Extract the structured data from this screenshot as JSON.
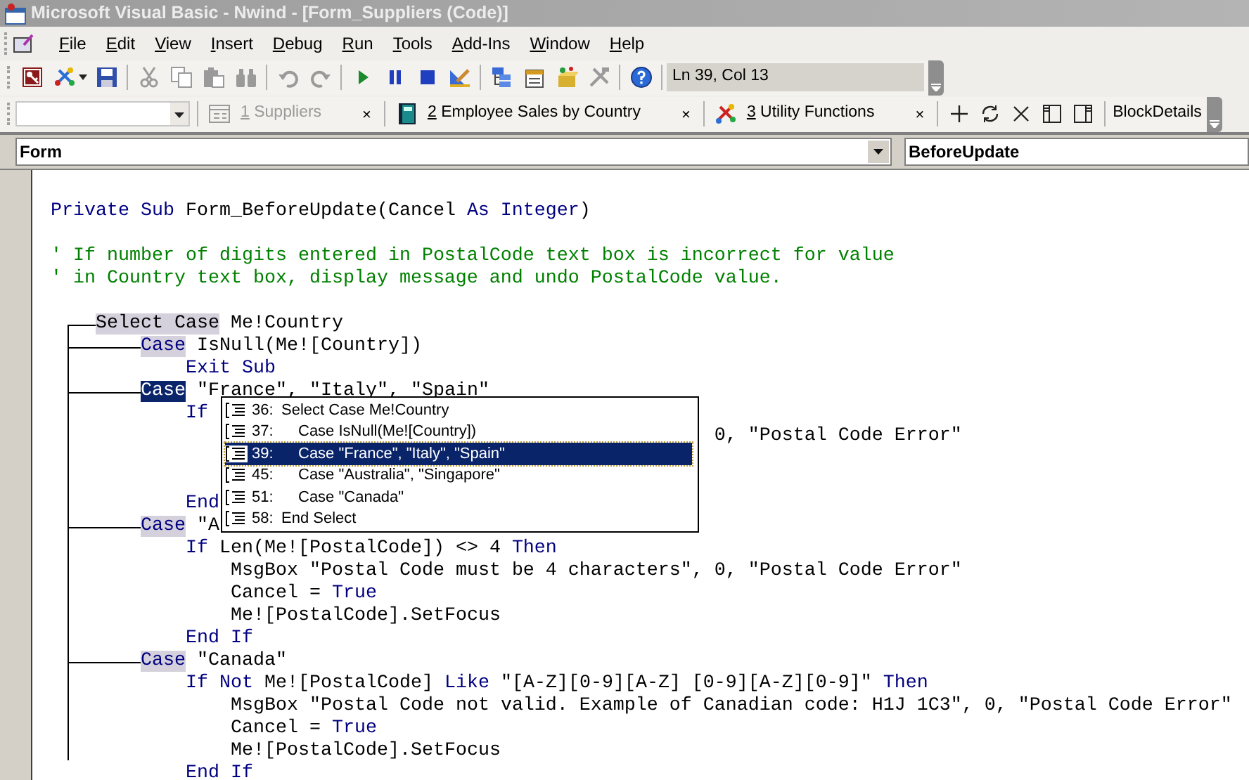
{
  "window": {
    "title": "Microsoft Visual Basic - Nwind - [Form_Suppliers (Code)]"
  },
  "menu": [
    {
      "mnemonic": "F",
      "rest": "ile"
    },
    {
      "mnemonic": "E",
      "rest": "dit"
    },
    {
      "mnemonic": "V",
      "rest": "iew"
    },
    {
      "mnemonic": "I",
      "rest": "nsert"
    },
    {
      "mnemonic": "D",
      "rest": "ebug"
    },
    {
      "mnemonic": "R",
      "rest": "un"
    },
    {
      "mnemonic": "T",
      "rest": "ools"
    },
    {
      "mnemonic": "A",
      "rest": "dd-Ins"
    },
    {
      "mnemonic": "W",
      "rest": "indow"
    },
    {
      "mnemonic": "H",
      "rest": "elp"
    }
  ],
  "standard_toolbar": {
    "groups": [
      [
        {
          "kind": "access",
          "disabled": false
        },
        {
          "kind": "insert",
          "disabled": false
        },
        {
          "kind": "save",
          "disabled": false
        }
      ],
      [
        {
          "kind": "cut",
          "disabled": true
        },
        {
          "kind": "copy",
          "disabled": true
        },
        {
          "kind": "paste",
          "disabled": true
        },
        {
          "kind": "find",
          "disabled": true
        }
      ],
      [
        {
          "kind": "undo",
          "disabled": true
        },
        {
          "kind": "redo",
          "disabled": true
        }
      ],
      [
        {
          "kind": "run",
          "disabled": false
        },
        {
          "kind": "pause",
          "disabled": false
        },
        {
          "kind": "stop",
          "disabled": false
        },
        {
          "kind": "design",
          "disabled": false
        }
      ],
      [
        {
          "kind": "project",
          "disabled": false
        },
        {
          "kind": "properties",
          "disabled": false
        },
        {
          "kind": "browser",
          "disabled": false
        },
        {
          "kind": "toolbox",
          "disabled": true
        }
      ],
      [
        {
          "kind": "help",
          "disabled": false
        }
      ]
    ],
    "position": "Ln 39, Col 13"
  },
  "bookmark_toolbar": {
    "tabs": [
      {
        "kind": "form",
        "key": "1",
        "label": "Suppliers",
        "disabled": true,
        "close": "×"
      },
      {
        "kind": "book",
        "key": "2",
        "label": "Employee Sales by Country",
        "disabled": false,
        "close": "×"
      },
      {
        "kind": "tools",
        "key": "3",
        "label": "Utility Functions",
        "disabled": false,
        "close": "×"
      }
    ],
    "actions": [
      {
        "kind": "add"
      },
      {
        "kind": "refresh"
      },
      {
        "kind": "delete"
      },
      {
        "kind": "panel_left"
      },
      {
        "kind": "panel_right"
      }
    ],
    "label": "BlockDetails"
  },
  "object_box": {
    "value": "Form"
  },
  "procedure_box": {
    "value": "BeforeUpdate"
  },
  "code": {
    "lines": [
      {
        "kind": "code",
        "segments": [
          {
            "kind": "keyword",
            "text": "Private Sub"
          },
          {
            "kind": "plain",
            "text": " Form_BeforeUpdate(Cancel "
          },
          {
            "kind": "keyword",
            "text": "As Integer"
          },
          {
            "kind": "plain",
            "text": ")"
          }
        ]
      },
      {
        "kind": "blank"
      },
      {
        "kind": "code",
        "segments": [
          {
            "kind": "comment",
            "text": "' If number of digits entered in PostalCode text box is incorrect for value"
          }
        ]
      },
      {
        "kind": "code",
        "segments": [
          {
            "kind": "comment",
            "text": "' in Country text box, display message and undo PostalCode value."
          }
        ]
      },
      {
        "kind": "blank"
      },
      {
        "kind": "branch_start",
        "segments": [
          {
            "kind": "block_plain",
            "text": "    Select Case"
          },
          {
            "kind": "plain",
            "text": " Me!Country"
          }
        ]
      },
      {
        "kind": "branch",
        "segments": [
          {
            "kind": "block_keyword",
            "text": "        Case"
          },
          {
            "kind": "plain",
            "text": " IsNull(Me![Country])"
          }
        ]
      },
      {
        "kind": "code",
        "segments": [
          {
            "kind": "keyword",
            "text": "            Exit Sub"
          }
        ]
      },
      {
        "kind": "branch",
        "segments": [
          {
            "kind": "selected_keyword",
            "text": "        Case"
          },
          {
            "kind": "plain",
            "text": " \"France\", \"Italy\", \"Spain\""
          }
        ]
      },
      {
        "kind": "code",
        "segments": [
          {
            "kind": "keyword",
            "text": "            If"
          }
        ]
      },
      {
        "kind": "code",
        "segments": [
          {
            "kind": "plain",
            "text": "                                                           0, \"Postal Code Error\""
          }
        ]
      },
      {
        "kind": "blank"
      },
      {
        "kind": "blank"
      },
      {
        "kind": "code",
        "segments": [
          {
            "kind": "keyword",
            "text": "            End"
          }
        ]
      },
      {
        "kind": "branch",
        "segments": [
          {
            "kind": "block_keyword",
            "text": "        Case"
          },
          {
            "kind": "plain",
            "text": " \"A"
          }
        ]
      },
      {
        "kind": "code",
        "segments": [
          {
            "kind": "keyword",
            "text": "            If"
          },
          {
            "kind": "plain",
            "text": " Len(Me![PostalCode]) <> 4 "
          },
          {
            "kind": "keyword",
            "text": "Then"
          }
        ]
      },
      {
        "kind": "code",
        "segments": [
          {
            "kind": "plain",
            "text": "                MsgBox \"Postal Code must be 4 characters\", 0, \"Postal Code Error\""
          }
        ]
      },
      {
        "kind": "code",
        "segments": [
          {
            "kind": "plain",
            "text": "                Cancel = "
          },
          {
            "kind": "keyword",
            "text": "True"
          }
        ]
      },
      {
        "kind": "code",
        "segments": [
          {
            "kind": "plain",
            "text": "                Me![PostalCode].SetFocus"
          }
        ]
      },
      {
        "kind": "code",
        "segments": [
          {
            "kind": "keyword",
            "text": "            End If"
          }
        ]
      },
      {
        "kind": "branch",
        "segments": [
          {
            "kind": "block_keyword",
            "text": "        Case"
          },
          {
            "kind": "plain",
            "text": " \"Canada\""
          }
        ]
      },
      {
        "kind": "code",
        "segments": [
          {
            "kind": "keyword",
            "text": "            If Not"
          },
          {
            "kind": "plain",
            "text": " Me![PostalCode] "
          },
          {
            "kind": "keyword",
            "text": "Like"
          },
          {
            "kind": "plain",
            "text": " \"[A-Z][0-9][A-Z] [0-9][A-Z][0-9]\" "
          },
          {
            "kind": "keyword",
            "text": "Then"
          }
        ]
      },
      {
        "kind": "code",
        "segments": [
          {
            "kind": "plain",
            "text": "                MsgBox \"Postal Code not valid. Example of Canadian code: H1J 1C3\", 0, \"Postal Code Error\""
          }
        ]
      },
      {
        "kind": "code",
        "segments": [
          {
            "kind": "plain",
            "text": "                Cancel = "
          },
          {
            "kind": "keyword",
            "text": "True"
          }
        ]
      },
      {
        "kind": "code",
        "segments": [
          {
            "kind": "plain",
            "text": "                Me![PostalCode].SetFocus"
          }
        ]
      },
      {
        "kind": "code",
        "segments": [
          {
            "kind": "keyword",
            "text": "            End If"
          }
        ]
      }
    ]
  },
  "block_list": {
    "items": [
      {
        "number": "36:",
        "text": "Select Case Me!Country",
        "selected": false,
        "children": [
          {
            "number": "37:",
            "text": "Case IsNull(Me![Country])",
            "selected": false
          },
          {
            "number": "39:",
            "text": "Case \"France\", \"Italy\", \"Spain\"",
            "selected": true
          },
          {
            "number": "45:",
            "text": "Case \"Australia\", \"Singapore\"",
            "selected": false
          },
          {
            "number": "51:",
            "text": "Case \"Canada\"",
            "selected": false
          }
        ]
      },
      {
        "number": "58:",
        "text": "End Select",
        "selected": false
      }
    ]
  }
}
